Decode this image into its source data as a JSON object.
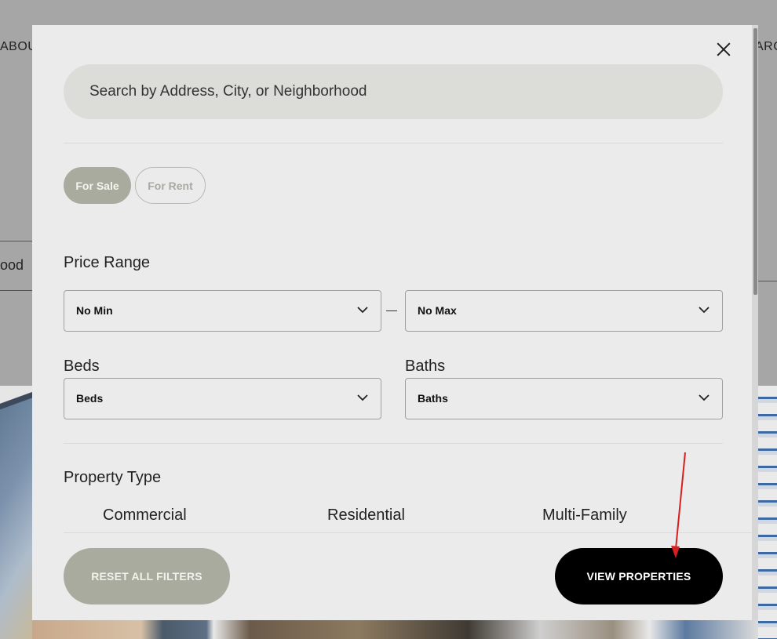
{
  "background": {
    "nav_left": "ABOU",
    "nav_right": "ARC",
    "search_fragment": "ood"
  },
  "modal": {
    "search": {
      "placeholder": "Search by Address, City, or Neighborhood"
    },
    "listing_type": {
      "for_sale": "For Sale",
      "for_rent": "For Rent",
      "selected": "For Sale"
    },
    "price_range": {
      "label": "Price Range",
      "min_value": "No Min",
      "max_value": "No Max",
      "separator": "—"
    },
    "beds": {
      "label": "Beds",
      "value": "Beds"
    },
    "baths": {
      "label": "Baths",
      "value": "Baths"
    },
    "property_type": {
      "label": "Property Type",
      "options": [
        "Commercial",
        "Residential",
        "Multi-Family"
      ]
    },
    "buttons": {
      "reset": "RESET ALL FILTERS",
      "view": "VIEW PROPERTIES"
    }
  },
  "colors": {
    "accent_pill": "#aaab9f",
    "primary_button": "#000000",
    "annotation_arrow": "#d81f1f"
  }
}
